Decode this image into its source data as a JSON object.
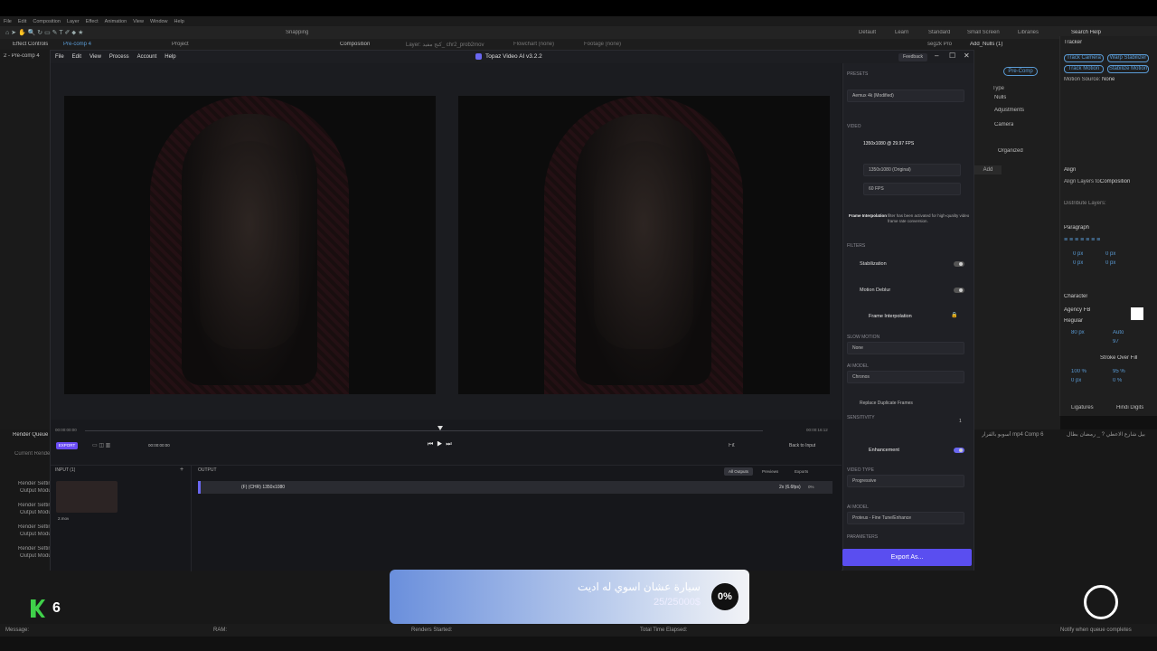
{
  "ae": {
    "menu": [
      "File",
      "Edit",
      "Composition",
      "Layer",
      "Effect",
      "Animation",
      "View",
      "Window",
      "Help"
    ],
    "snapping": "Snapping",
    "effect_controls": "Effect Controls",
    "effect_controls_target": "Pre-comp 4",
    "project": "Project",
    "composition_tab": "Composition",
    "composition_name": "Pre-comp 4",
    "layer_tab": "Layer: كنج مفيد_ chr2_prob2mov",
    "flowchart": "Flowchart (none)",
    "footage": "Footage (none)",
    "workspaces": [
      "Default",
      "Learn",
      "Standard",
      "Small Screen",
      "Libraries"
    ],
    "search_help": "Search Help",
    "left_item": "2 - Pre-comp 4",
    "seg_pro": "seg2k Pro",
    "add_nulls": "Add_Nulls (1)",
    "tracker": {
      "title": "Tracker",
      "buttons": [
        "Track Camera",
        "Warp Stabilizer",
        "Track Motion",
        "Stabilize Motion"
      ],
      "motion_source_label": "Motion Source:",
      "motion_source_value": "None"
    },
    "precomp_button": "Pre-Comp",
    "type_label": "Type",
    "types": [
      "Nulls",
      "Adjustments",
      "Camera"
    ],
    "organized": "Organized",
    "add_button": "Add",
    "align": {
      "title": "Align",
      "layers_to_label": "Align Layers to:",
      "layers_to_value": "Composition",
      "distribute": "Distribute Layers:"
    },
    "paragraph": {
      "title": "Paragraph",
      "indent_values": [
        "0 px",
        "0 px",
        "0 px",
        "0 px"
      ]
    },
    "character": {
      "title": "Character",
      "font": "Agency FB",
      "style": "Regular",
      "size": "80 px",
      "leading": "Auto",
      "tracking": "97",
      "stroke": "Stroke Over Fill",
      "scale_v": "100 %",
      "scale_h": "95 %",
      "baseline": "0 px",
      "tsume": "0 %",
      "ligatures": "Ligatures",
      "hindi_digits": "Hindi Digits"
    },
    "render_queue": "Render Queue",
    "current_render": "Current Render",
    "render_rows": [
      "Render Settings",
      "Output Module",
      "Render Settings",
      "Output Module",
      "Render Settings",
      "Output Module",
      "Render Settings",
      "Output Module"
    ],
    "comp_tabs": [
      "بيل شارع الاعطي ? _ رمضان بطال",
      "أسوبو بالقرار mp4 Comp 6"
    ],
    "status": {
      "message": "Message:",
      "ram": "RAM:",
      "renders_started": "Renders Started:",
      "total_time": "Total Time Elapsed:",
      "notify": "Notify when queue completes"
    }
  },
  "topaz": {
    "menu": [
      "File",
      "Edit",
      "View",
      "Process",
      "Account",
      "Help"
    ],
    "title": "Topaz Video AI  v3.2.2",
    "feedback": "Feedback",
    "timecode_start": "00:00:00:00",
    "timecode_end": "00:00:16:12",
    "current_time": "00:00:00:00",
    "export_label": "EXPORT",
    "fit": "Fit",
    "back_to_input": "Back to Input",
    "input_label": "INPUT (1)",
    "input_file": "2.mov",
    "output_label": "OUTPUT",
    "output_tabs": [
      "All Outputs",
      "Previews",
      "Exports"
    ],
    "output_row": {
      "desc": "(F) (CHR) 1350x1080",
      "fps": "2x (6.6fps)",
      "pct": "0%"
    },
    "presets_title": "PRESETS",
    "preset_value": "Aemux 4k (Modified)",
    "video_title": "VIDEO",
    "video_in": "1350x1080 @ 29.97 FPS",
    "video_out_res": "1350x1080 (Original)",
    "video_out_fps": "60 FPS",
    "interp_note_bold": "Frame Interpolation",
    "interp_note": "filter has been activated for high-quality video frame rate conversion.",
    "filters_title": "FILTERS",
    "filters": [
      {
        "name": "Stabilization",
        "on": false
      },
      {
        "name": "Motion Deblur",
        "on": false
      }
    ],
    "frame_interp": {
      "name": "Frame Interpolation",
      "slow_motion_label": "SLOW MOTION",
      "slow_motion_value": "None",
      "ai_model_label": "AI MODEL",
      "ai_model_value": "Chronos",
      "replace_dup": "Replace Duplicate Frames",
      "sensitivity_label": "SENSITIVITY",
      "sensitivity_value": "1"
    },
    "enhancement": {
      "name": "Enhancement",
      "on": true,
      "video_type_label": "VIDEO TYPE",
      "video_type_value": "Progressive",
      "ai_model_label": "AI MODEL",
      "ai_model_value": "Proteus - Fine Tune/Enhance",
      "parameters_label": "PARAMETERS"
    },
    "export_as": "Export As..."
  },
  "overlay": {
    "percent": "0%",
    "title": "سيارة عشان اسوي له اديت",
    "subtitle": "25/25000$",
    "k_number": "6"
  },
  "colors": {
    "accent": "#6a67f0",
    "export_blue": "#5a4ef0",
    "kick_green": "#3fd14a"
  }
}
